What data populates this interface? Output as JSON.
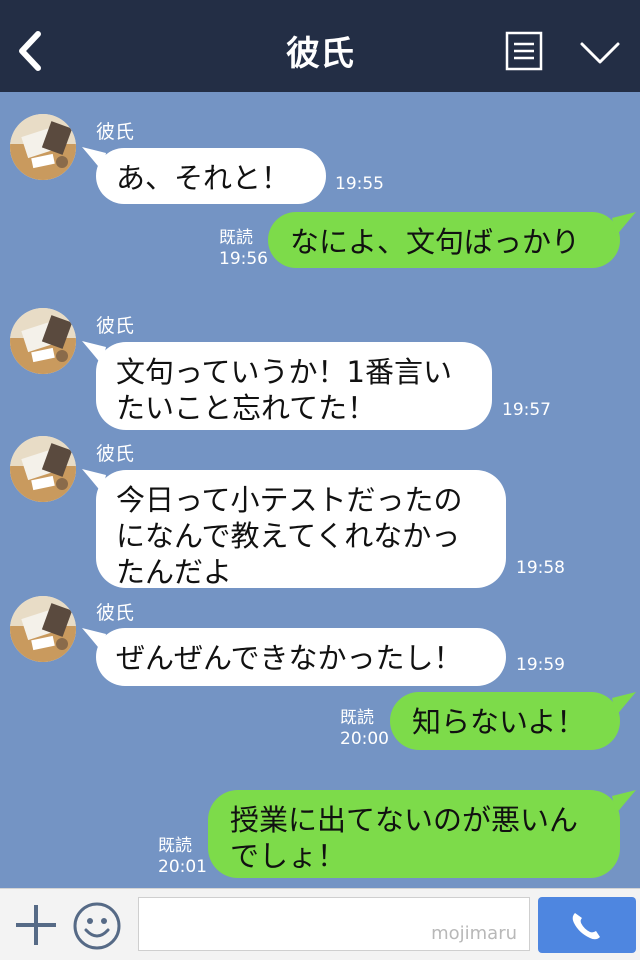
{
  "header": {
    "title": "彼氏"
  },
  "messages": [
    {
      "side": "left",
      "sender": "彼氏",
      "text": "あ、それと！",
      "time": "19:55"
    },
    {
      "side": "right",
      "text": "なによ、文句ばっかり",
      "read": "既読",
      "time": "19:56"
    },
    {
      "side": "left",
      "sender": "彼氏",
      "text": "文句っていうか！1番言いたいこと忘れてた！",
      "time": "19:57"
    },
    {
      "side": "left",
      "sender": "彼氏",
      "text": "今日って小テストだったのになんで教えてくれなかったんだよ",
      "time": "19:58"
    },
    {
      "side": "left",
      "sender": "彼氏",
      "text": "ぜんぜんできなかったし！",
      "time": "19:59"
    },
    {
      "side": "right",
      "text": "知らないよ！",
      "read": "既読",
      "time": "20:00"
    },
    {
      "side": "right",
      "text": "授業に出てないのが悪いんでしょ！",
      "read": "既読",
      "time": "20:01"
    }
  ],
  "footer": {
    "input_value": "",
    "watermark": "mojimaru"
  },
  "colors": {
    "header_bg": "#232e45",
    "chat_bg": "#7494c4",
    "left_bubble": "#ffffff",
    "right_bubble": "#7ddb4a",
    "call_button": "#4e86e0"
  }
}
